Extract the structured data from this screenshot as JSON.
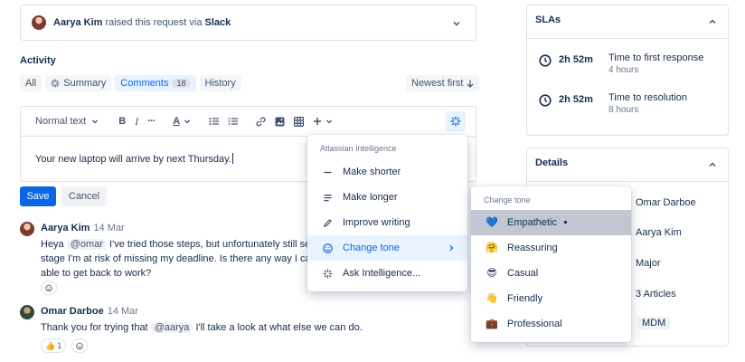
{
  "banner": {
    "user": "Aarya Kim",
    "middle": "raised this request via",
    "channel": "Slack"
  },
  "activity": {
    "title": "Activity",
    "filters": {
      "all": "All",
      "summary": "Summary",
      "comments": "Comments",
      "comments_count": "18",
      "history": "History"
    },
    "sort": "Newest first"
  },
  "editor": {
    "format": "Normal text",
    "bold": "B",
    "italic": "I",
    "more": "···",
    "color": "A",
    "text": "Your new laptop will arrive by next Thursday."
  },
  "actions": {
    "save": "Save",
    "cancel": "Cancel"
  },
  "comments": [
    {
      "name": "Aarya Kim",
      "date": "14 Mar",
      "line1a": "Heya",
      "mention": "@omar",
      "line1b": "I've tried those steps, but unfortunately still seem",
      "line2": "stage I'm at risk of missing my deadline. Is there any way I can g",
      "line3": "able to get back to work?"
    },
    {
      "name": "Omar Darboe",
      "date": "14 Mar",
      "line1a": "Thank you for trying that",
      "mention": "@aarya",
      "line1b": "I'll take a look at what else we can do.",
      "reaction_count": "1"
    }
  ],
  "sla": {
    "title": "SLAs",
    "items": [
      {
        "time": "2h 52m",
        "label": "Time to first response",
        "sub": "4 hours"
      },
      {
        "time": "2h 52m",
        "label": "Time to resolution",
        "sub": "8 hours"
      }
    ]
  },
  "details": {
    "title": "Details",
    "values": [
      "Omar Darboe",
      "Aarya Kim",
      "Major",
      "3 Articles",
      "MDM"
    ]
  },
  "ai_menu": {
    "header": "Atlassian Intelligence",
    "items": [
      "Make shorter",
      "Make longer",
      "Improve writing",
      "Change tone",
      "Ask Intelligence..."
    ]
  },
  "tone_menu": {
    "header": "Change tone",
    "items": [
      {
        "label": "Empathetic",
        "emoji": "💙"
      },
      {
        "label": "Reassuring",
        "emoji": "🤗"
      },
      {
        "label": "Casual",
        "emoji": "😎"
      },
      {
        "label": "Friendly",
        "emoji": "👋"
      },
      {
        "label": "Professional",
        "emoji": "💼"
      }
    ]
  },
  "colors": {
    "accent": "#0c66e4",
    "selected_bg": "#e9f2ff",
    "hover_grey": "#c1c7d0"
  }
}
